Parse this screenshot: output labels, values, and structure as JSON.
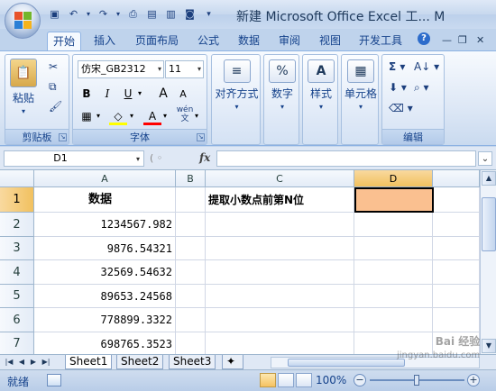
{
  "window": {
    "title": "新建 Microsoft Office Excel 工... M"
  },
  "ribbon_tabs": [
    "开始",
    "插入",
    "页面布局",
    "公式",
    "数据",
    "审阅",
    "视图",
    "开发工具"
  ],
  "clipboard": {
    "paste_label": "粘贴",
    "group_label": "剪贴板"
  },
  "font": {
    "name": "仿宋_GB2312",
    "size": "11",
    "bold": "B",
    "italic": "I",
    "underline": "U",
    "grow": "A",
    "shrink": "A",
    "color_letter": "A",
    "wen": "wén\n文",
    "group_label": "字体"
  },
  "alignment": {
    "label": "对齐方式"
  },
  "number": {
    "label": "数字",
    "icon": "%"
  },
  "styles": {
    "label": "样式"
  },
  "cells_group": {
    "label": "单元格"
  },
  "editing": {
    "group_label": "编辑"
  },
  "formula_bar": {
    "name_box": "D1",
    "fx": "fx",
    "formula": ""
  },
  "grid": {
    "columns": [
      "A",
      "B",
      "C",
      "D"
    ],
    "selected_column": "D",
    "rows": [
      "1",
      "2",
      "3",
      "4",
      "5",
      "6",
      "7"
    ],
    "selected_row": "1",
    "cells": {
      "A1": "数据",
      "C1": "提取小数点前第N位",
      "A2": "1234567.982",
      "A3": "9876.54321",
      "A4": "32569.54632",
      "A5": "89653.24568",
      "A6": "778899.3322",
      "A7": "698765.3523"
    },
    "active_cell": "D1",
    "active_fill": "#fac090"
  },
  "sheets": {
    "tabs": [
      "Sheet1",
      "Sheet2",
      "Sheet3"
    ],
    "active": "Sheet1"
  },
  "status": {
    "ready": "就绪",
    "zoom": "100%"
  },
  "watermark": {
    "line1": "Bai 经验",
    "line2": "jingyan.baidu.com"
  }
}
